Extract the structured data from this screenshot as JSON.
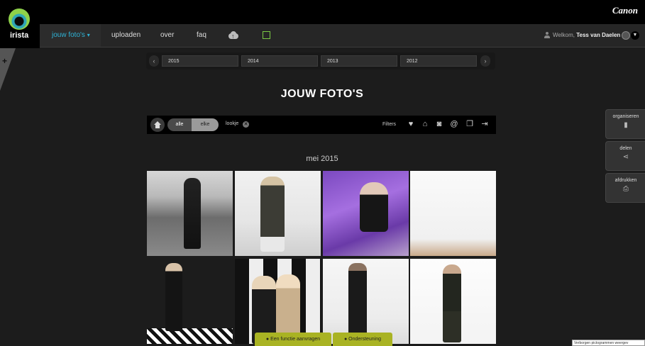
{
  "brand": {
    "logo_text": "irista",
    "canon": "Canon"
  },
  "nav": {
    "items": [
      "jouw foto's",
      "uploaden",
      "over",
      "faq"
    ],
    "active_index": 0,
    "active_caret": "▾"
  },
  "user": {
    "welcome": "Welkom,",
    "name": "Tess van Daelen"
  },
  "side_tab": {
    "label": "+"
  },
  "years": {
    "tabs": [
      "2015",
      "2014",
      "2013",
      "2012"
    ],
    "prev": "‹",
    "next": "›"
  },
  "page": {
    "title": "JOUW FOTO'S"
  },
  "filterbar": {
    "segments": [
      "alle",
      "elke"
    ],
    "tag": "lookje",
    "tag_remove": "✕",
    "filters_label": "Filters"
  },
  "gallery": {
    "month": "mei 2015"
  },
  "right_panel": [
    {
      "label": "organiseren",
      "icon": "album-icon"
    },
    {
      "label": "delen",
      "icon": "share-icon"
    },
    {
      "label": "afdrukken",
      "icon": "printer-icon"
    }
  ],
  "help": {
    "feature_request": "Een functie aanvragen",
    "support": "Ondersteuning"
  },
  "taskbar": {
    "hidden_icons": "Verborgen pictogrammen weergev"
  },
  "colors": {
    "accent": "#2fb3d6",
    "help_green": "#a9b323"
  }
}
